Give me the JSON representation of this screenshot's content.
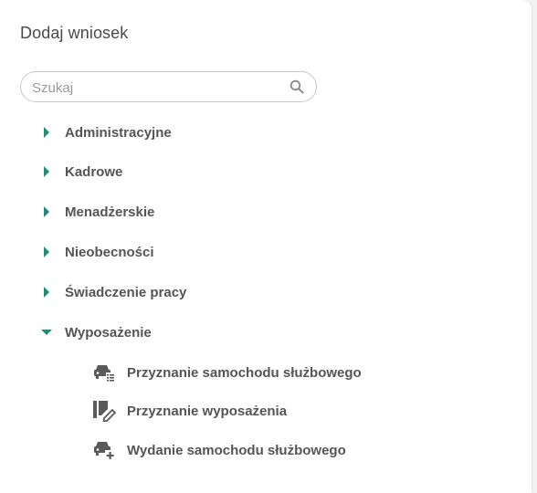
{
  "panel": {
    "title": "Dodaj wniosek"
  },
  "search": {
    "placeholder": "Szukaj",
    "value": "",
    "icon": "search-icon"
  },
  "colors": {
    "accent": "#1a8f7a",
    "text": "#555555",
    "icon": "#5a5a5a"
  },
  "categories": [
    {
      "label": "Administracyjne",
      "expanded": false
    },
    {
      "label": "Kadrowe",
      "expanded": false
    },
    {
      "label": "Menadżerskie",
      "expanded": false
    },
    {
      "label": "Nieobecności",
      "expanded": false
    },
    {
      "label": "Świadczenie pracy",
      "expanded": false
    },
    {
      "label": "Wyposażenie",
      "expanded": true
    }
  ],
  "subitems": [
    {
      "label": "Przyznanie samochodu służbowego",
      "icon": "car-list-icon"
    },
    {
      "label": "Przyznanie wyposażenia",
      "icon": "equipment-edit-icon"
    },
    {
      "label": "Wydanie samochodu służbowego",
      "icon": "car-add-icon"
    }
  ]
}
